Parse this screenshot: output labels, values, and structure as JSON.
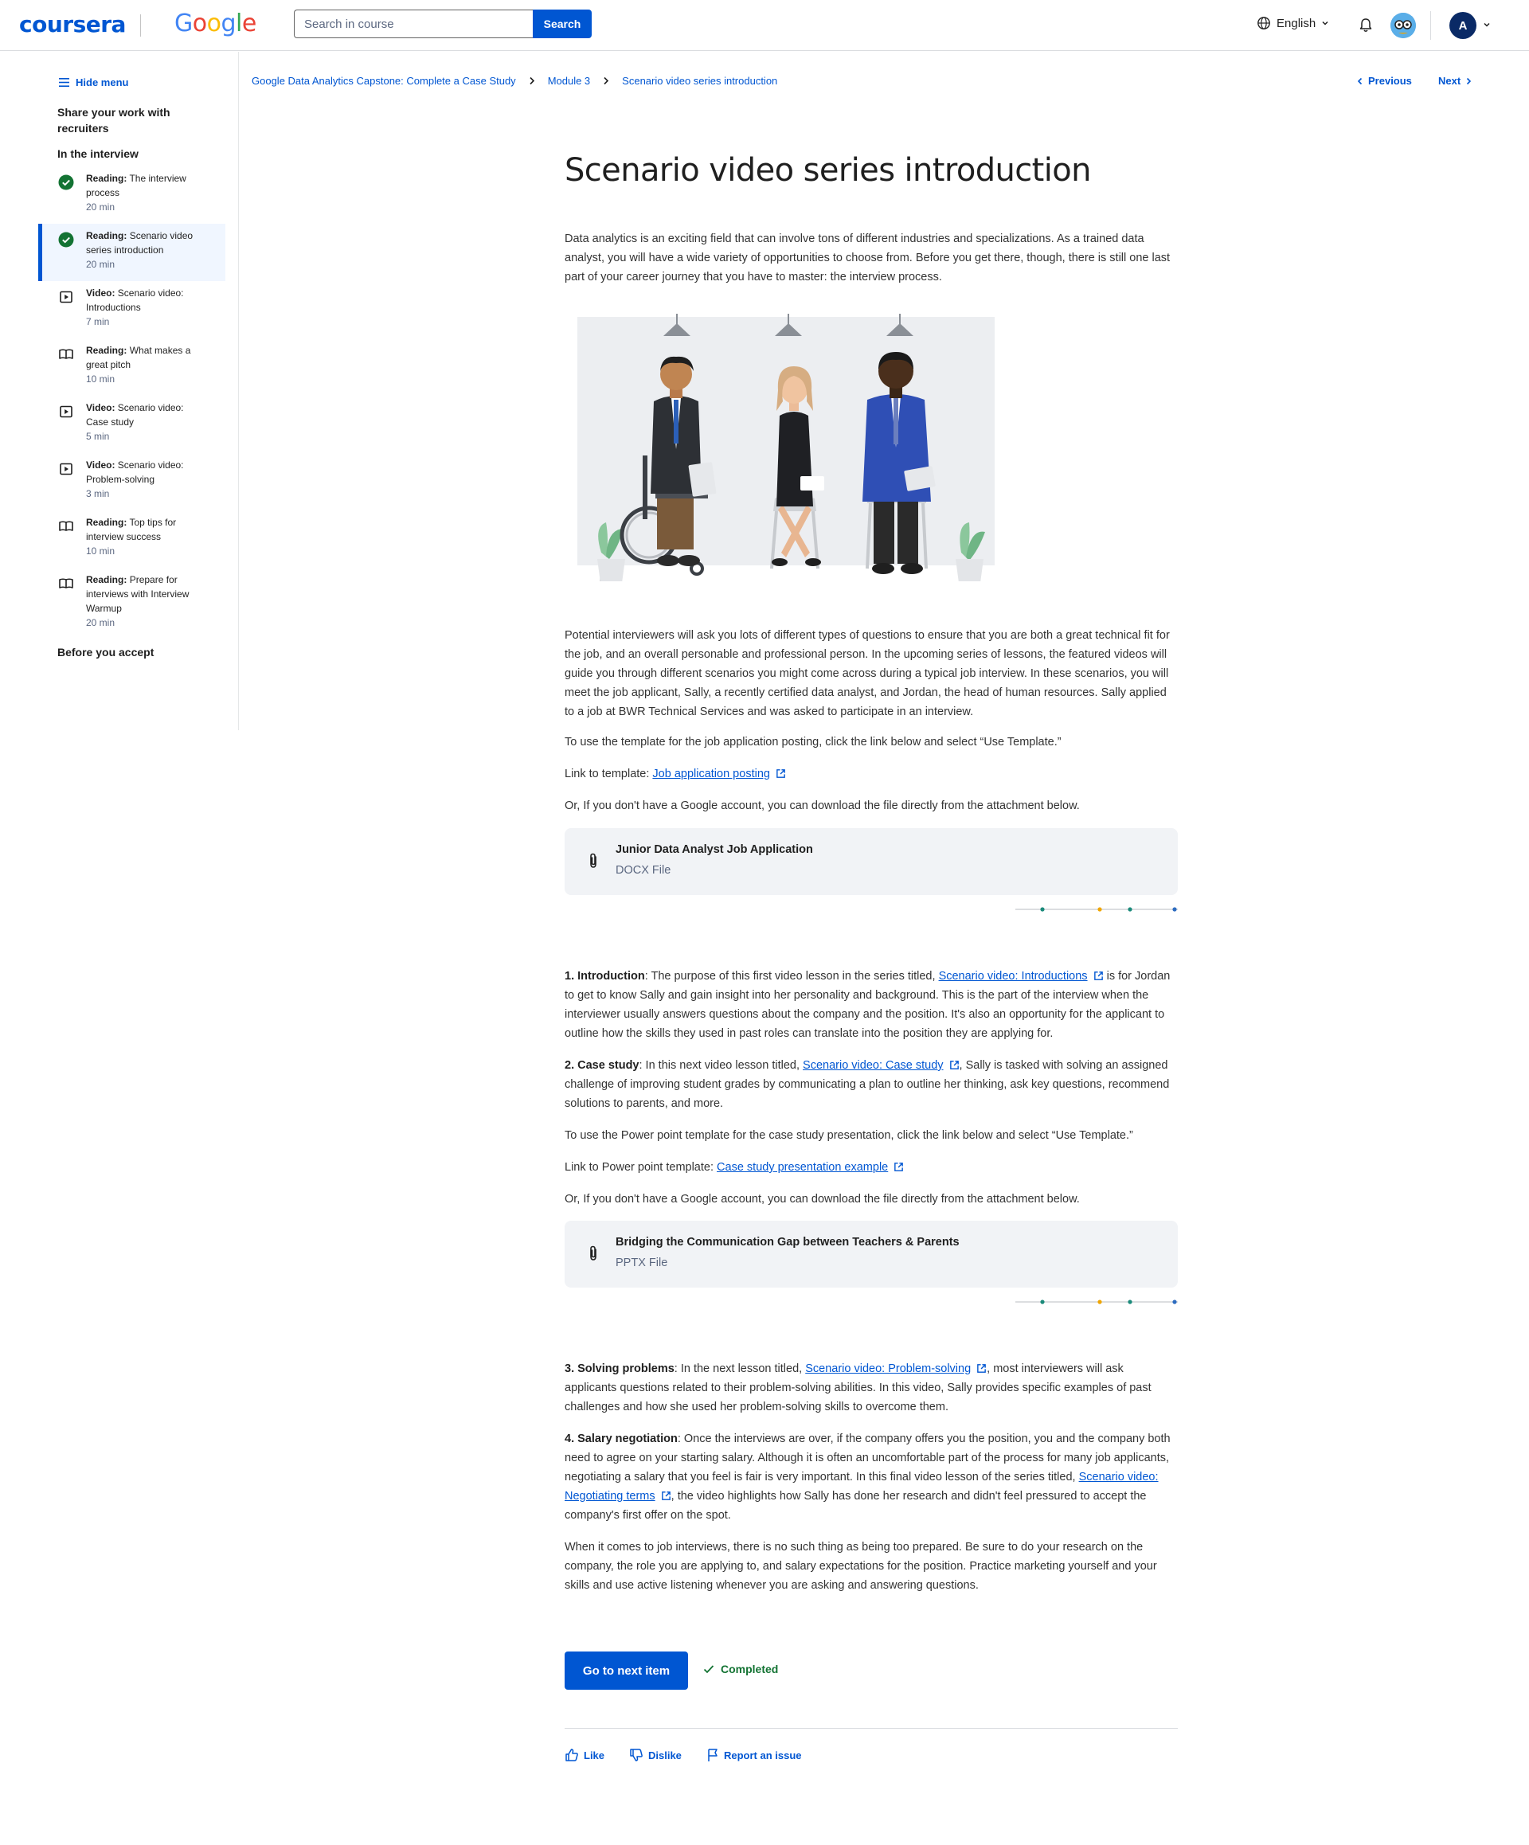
{
  "header": {
    "logo": "coursera",
    "partner_logo": "Google",
    "search_placeholder": "Search in course",
    "search_button": "Search",
    "language": "English",
    "avatar_initial": "A"
  },
  "sidebar": {
    "hide_menu": "Hide menu",
    "section_top": "Share your work with recruiters",
    "section_current": "In the interview",
    "section_bottom": "Before you accept",
    "items": [
      {
        "kind": "Reading:",
        "title": "The interview process",
        "duration": "20 min",
        "icon": "completed-check-icon"
      },
      {
        "kind": "Reading:",
        "title": "Scenario video series introduction",
        "duration": "20 min",
        "icon": "completed-check-icon"
      },
      {
        "kind": "Video:",
        "title": "Scenario video: Introductions",
        "duration": "7 min",
        "icon": "play-video-icon"
      },
      {
        "kind": "Reading:",
        "title": "What makes a great pitch",
        "duration": "10 min",
        "icon": "book-reading-icon"
      },
      {
        "kind": "Video:",
        "title": "Scenario video: Case study",
        "duration": "5 min",
        "icon": "play-video-icon"
      },
      {
        "kind": "Video:",
        "title": "Scenario video: Problem-solving",
        "duration": "3 min",
        "icon": "play-video-icon"
      },
      {
        "kind": "Reading:",
        "title": "Top tips for interview success",
        "duration": "10 min",
        "icon": "book-reading-icon"
      },
      {
        "kind": "Reading:",
        "title": "Prepare for interviews with Interview Warmup",
        "duration": "20 min",
        "icon": "book-reading-icon"
      }
    ]
  },
  "breadcrumb": {
    "course": "Google Data Analytics Capstone: Complete a Case Study",
    "module": "Module 3",
    "page": "Scenario video series introduction"
  },
  "nav": {
    "previous": "Previous",
    "next": "Next"
  },
  "main": {
    "title": "Scenario video series introduction",
    "intro": "Data analytics is an exciting field that can involve tons of different industries and specializations. As a trained data analyst, you will have a wide variety of opportunities to choose from. Before you get there, though, there is still one last part of your career journey that you have to master: the interview process.",
    "p_interviewers": "Potential interviewers will ask you lots of different types of questions to ensure that you are both a great technical fit for the job, and an overall personable and professional person. In the upcoming series of lessons, the featured videos will guide you through different scenarios you might come across during a typical job interview. In these scenarios, you will meet the job applicant, Sally, a recently certified data analyst, and Jordan, the head of human resources. Sally applied to a job at BWR Technical Services and was asked to participate in an interview.",
    "p_template_use": "To use the template for the job application posting, click the link below and select “Use Template.”",
    "p_template_label": "Link to template: ",
    "p_template_link": "Job application posting",
    "p_no_account": "Or, If you don't have a Google account, you can download the file directly from the attachment below.",
    "attachment1": {
      "name": "Junior Data Analyst Job Application",
      "type": "DOCX File"
    },
    "s1_label": "1. Introduction",
    "s1_pre": ": The purpose of this first video lesson in the series titled, ",
    "s1_link": "Scenario video: Introductions",
    "s1_post": " is for Jordan to get to know Sally and gain insight into her personality and background. This is the part of the interview when the interviewer usually answers questions about the company and the position. It's also an opportunity for the applicant to outline how the skills they used in past roles can translate into the position they are applying for.",
    "s2_label": "2. Case study",
    "s2_pre": ": In this next video lesson titled, ",
    "s2_link": "Scenario video: Case study",
    "s2_post": ", Sally is tasked with solving an assigned challenge of improving student grades by communicating a plan to outline her thinking, ask key questions, recommend solutions to parents, and more.",
    "p_ppt_use": "To use the Power point template for the case study presentation, click the link below and select “Use Template.”",
    "p_ppt_label": "Link to Power point template: ",
    "p_ppt_link": "Case study presentation example",
    "p_no_account2": "Or, If you don't have a Google account, you can download the file directly from the attachment below.",
    "attachment2": {
      "name": "Bridging the Communication Gap between Teachers & Parents",
      "type": "PPTX File"
    },
    "s3_label": "3. Solving problems",
    "s3_pre": ": In the next lesson titled, ",
    "s3_link": "Scenario video: Problem-solving",
    "s3_post": ", most interviewers will ask applicants questions related to their problem-solving abilities. In this video, Sally provides specific examples of past challenges and how she used her problem-solving skills to overcome them.",
    "s4_label": "4. Salary negotiation",
    "s4_pre": ": Once the interviews are over, if the company offers you the position, you and the company both need to agree on your starting salary. Although it is often an uncomfortable part of the process for many job applicants, negotiating a salary that you feel is fair is very important. In this final video lesson of the series titled, ",
    "s4_link": "Scenario video: Negotiating terms",
    "s4_post": ", the video highlights how Sally has done her research and didn't feel pressured to accept the company's first offer on the spot.",
    "closing": "When it comes to job interviews, there is no such thing as being too prepared. Be sure to do your research on the company, the role you are applying to, and salary expectations for the position. Practice marketing yourself and your skills and use active listening whenever you are asking and answering questions."
  },
  "actions": {
    "next_item": "Go to next item",
    "completed": "Completed"
  },
  "feedback": {
    "like": "Like",
    "dislike": "Dislike",
    "report": "Report an issue"
  },
  "colors": {
    "brand": "#0056d2",
    "success": "#137333",
    "sidebar_active": "#f0f6ff",
    "attachment_bg": "#f1f3f6"
  }
}
